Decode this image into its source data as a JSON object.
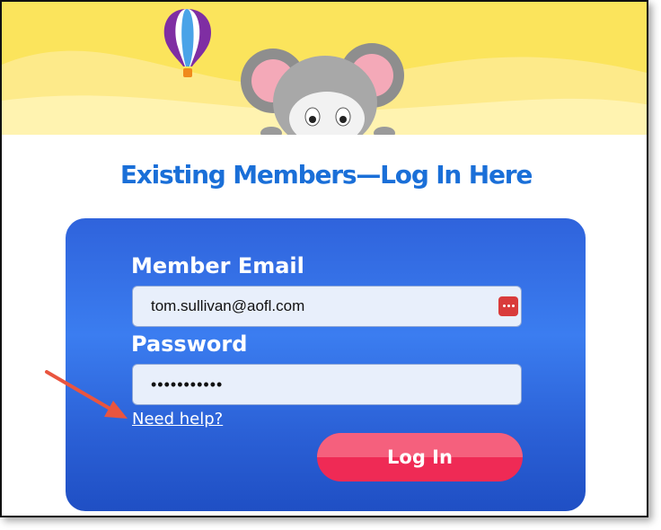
{
  "header": {
    "title": "Existing Members—Log In Here",
    "decorations": [
      "hot-air-balloon-icon",
      "mouse-mascot-icon"
    ]
  },
  "form": {
    "email_label": "Member Email",
    "email_value": "tom.sullivan@aofl.com",
    "password_label": "Password",
    "password_value": "•••••••••••",
    "help_link": "Need help?",
    "login_button": "Log In"
  },
  "colors": {
    "title": "#1a6fd8",
    "card": "#3b7df0",
    "button": "#ef2a55",
    "banner": "#fbe45c",
    "annotation_arrow": "#e9553f"
  }
}
